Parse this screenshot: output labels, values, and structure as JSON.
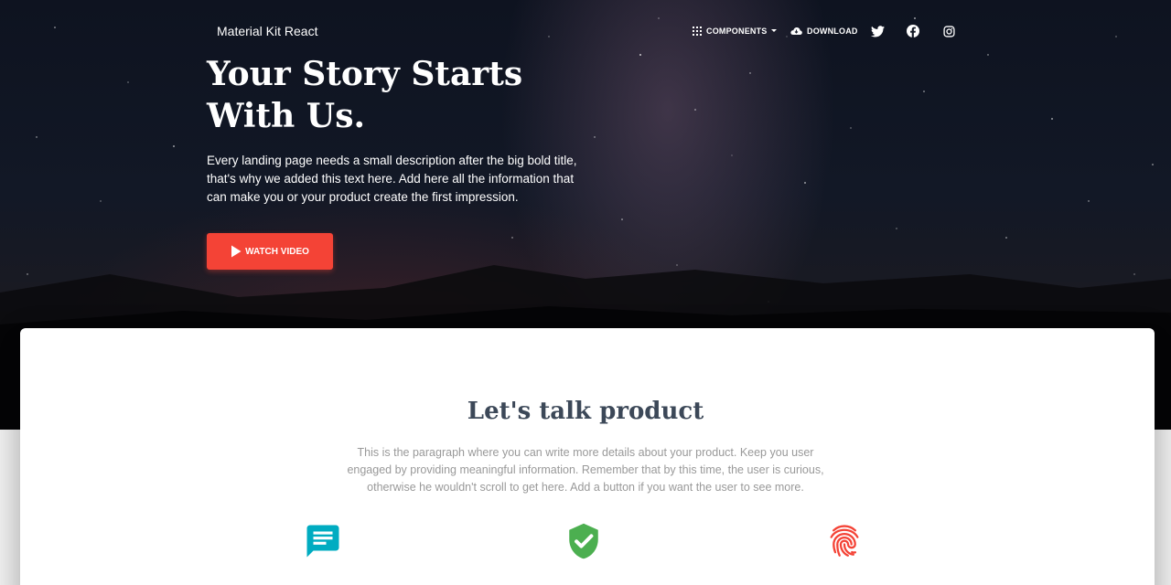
{
  "navbar": {
    "brand": "Material Kit React",
    "components_label": "COMPONENTS",
    "download_label": "DOWNLOAD",
    "icons": [
      "apps-icon",
      "cloud-download-icon",
      "twitter-icon",
      "facebook-icon",
      "instagram-icon",
      "caret-down-icon"
    ]
  },
  "hero": {
    "title": "Your Story Starts With Us.",
    "description": "Every landing page needs a small description after the big bold title, that's why we added this text here. Add here all the information that can make you or your product create the first impression.",
    "button_label": "WATCH VIDEO",
    "button_icon": "play-icon"
  },
  "product": {
    "title": "Let's talk product",
    "description": "This is the paragraph where you can write more details about your product. Keep you user engaged by providing meaningful information. Remember that by this time, the user is curious, otherwise he wouldn't scroll to get here. Add a button if you want the user to see more.",
    "features": [
      {
        "icon": "chat-icon",
        "color": "#00acc1"
      },
      {
        "icon": "verified-user-icon",
        "color": "#4caf50"
      },
      {
        "icon": "fingerprint-icon",
        "color": "#f44336"
      }
    ]
  },
  "colors": {
    "accent": "#f44336",
    "title_text": "#3c4858",
    "muted_text": "#999999"
  }
}
